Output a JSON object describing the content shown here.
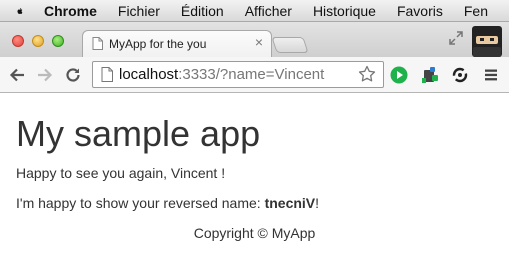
{
  "menubar": {
    "app_name": "Chrome",
    "items": [
      "Fichier",
      "Édition",
      "Afficher",
      "Historique",
      "Favoris",
      "Fen"
    ]
  },
  "tab": {
    "title": "MyApp for the you",
    "close_symbol": "×"
  },
  "omnibox": {
    "host": "localhost",
    "rest": ":3333/?name=Vincent"
  },
  "page": {
    "heading": "My sample app",
    "greeting": "Happy to see you again, Vincent !",
    "reversed_prefix": "I'm happy to show your reversed name: ",
    "reversed_name": "tnecniV",
    "reversed_suffix": "!",
    "footer": "Copyright © MyApp"
  },
  "icons": {
    "apple": "apple-icon",
    "favicon": "page-icon",
    "back": "back-arrow-icon",
    "forward": "forward-arrow-icon",
    "reload": "reload-icon",
    "star": "star-icon",
    "play": "play-extension-icon",
    "puzzle": "puzzle-extension-icon",
    "sync": "sync-extension-icon",
    "menu": "hamburger-menu-icon",
    "avatar": "ninja-avatar-icon",
    "fullscreen": "fullscreen-icon"
  },
  "colors": {
    "close": "#e0443e",
    "minimize": "#dea123",
    "maximize": "#3fae2a",
    "play_green": "#1fb14b",
    "text": "#333333"
  }
}
